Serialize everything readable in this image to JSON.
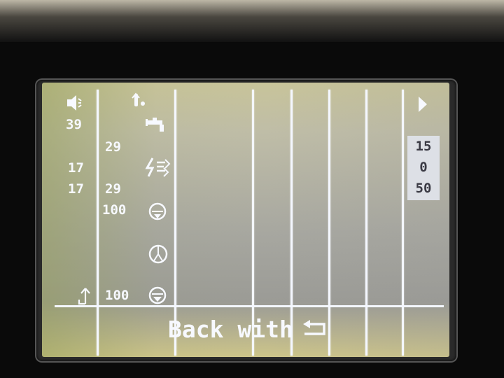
{
  "left_column": {
    "speaker_value": "39",
    "row3_value": "17",
    "row4_value": "17"
  },
  "mid_column": {
    "row2_value": "29",
    "row4_value": "29",
    "row5_value": "100",
    "bottom_value": "100"
  },
  "side_values": [
    "15",
    "0",
    "50"
  ],
  "footer": {
    "back_label": "Back with"
  },
  "icons": {
    "speaker": "speaker-icon",
    "temperature": "thermometer-icon",
    "faucet": "faucet-icon",
    "recirculation": "recirculation-icon",
    "dial_pump_1": "dial-icon",
    "dial_pump_2": "gauge-icon",
    "dial_pump_3": "dial-icon",
    "return": "return-arrow-icon",
    "scroll_right": "arrow-right-icon"
  },
  "colors": {
    "lcd_text": "#f7f9ff",
    "lcd_background": "#a7a7a0",
    "value_box": "#dde0e6"
  }
}
